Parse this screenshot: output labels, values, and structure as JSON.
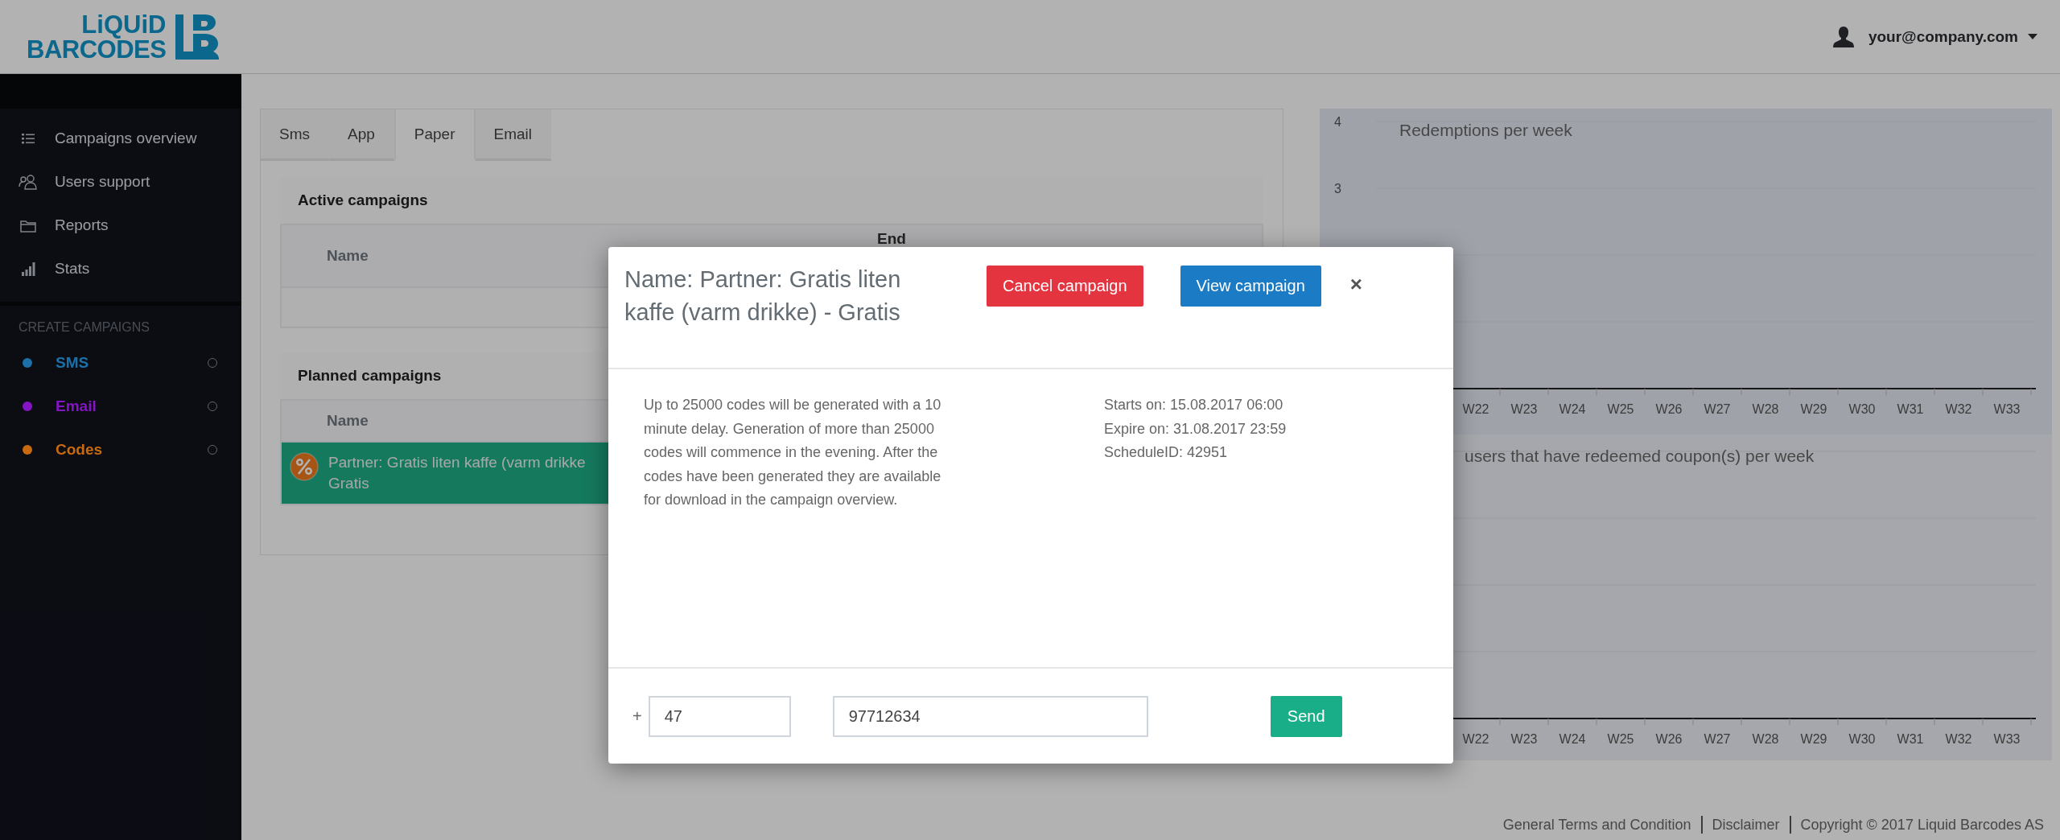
{
  "header": {
    "logo": {
      "line_1": "LiQUiD",
      "line_2": "BARCODES"
    },
    "user": {
      "email": "your@company.com"
    }
  },
  "sidebar": {
    "items": [
      {
        "label": "Campaigns overview"
      },
      {
        "label": "Users support"
      },
      {
        "label": "Reports"
      },
      {
        "label": "Stats"
      }
    ],
    "section_title": "CREATE CAMPAIGNS",
    "create_items": [
      {
        "label": "SMS",
        "color": "#1c70a8"
      },
      {
        "label": "Email",
        "color": "#8414c4"
      },
      {
        "label": "Codes",
        "color": "#c8690e"
      }
    ]
  },
  "tabs": [
    {
      "label": "Sms",
      "selected": false
    },
    {
      "label": "App",
      "selected": false
    },
    {
      "label": "Paper",
      "selected": true
    },
    {
      "label": "Email",
      "selected": false
    }
  ],
  "active_campaigns": {
    "title": "Active campaigns",
    "columns": [
      "Name",
      "End"
    ]
  },
  "planned_campaigns": {
    "title": "Planned campaigns",
    "columns": [
      "Name"
    ],
    "rows": [
      {
        "name_lines": [
          "Partner: Gratis liten kaffe (varm drikke",
          "Gratis"
        ],
        "selected": true
      }
    ]
  },
  "charts": [
    {
      "title": "Redemptions per week",
      "y_labels": [
        "4",
        "3"
      ],
      "x_labels": [
        "W22",
        "W23",
        "W24",
        "W25",
        "W26",
        "W27",
        "W28",
        "W29",
        "W30",
        "W31",
        "W32",
        "W33"
      ]
    },
    {
      "title": "users that have redeemed coupon(s) per week",
      "x_labels": [
        "W22",
        "W23",
        "W24",
        "W25",
        "W26",
        "W27",
        "W28",
        "W29",
        "W30",
        "W31",
        "W32",
        "W33"
      ]
    }
  ],
  "modal": {
    "title": "Name: Partner: Gratis liten kaffe (varm drikke) - Gratis",
    "buttons": [
      {
        "label": "Cancel campaign",
        "kind": "danger"
      },
      {
        "label": "View campaign",
        "kind": "primary"
      }
    ],
    "close": "×",
    "description": "Up to 25000 codes will be generated with a 10 minute delay. Generation of more than 25000 codes will commence in the evening. After the codes have been generated they are available for download in the campaign overview.",
    "details": [
      "Starts on: 15.08.2017 06:00",
      "Expire on: 31.08.2017 23:59",
      "ScheduleID: 42951"
    ],
    "phone": {
      "prefix": "+",
      "country_code": "47",
      "number": "97712634"
    },
    "send_button": "Send"
  },
  "footer": {
    "items": [
      "General Terms and Condition",
      "Disclaimer",
      "Copyright © 2017 Liquid Barcodes AS"
    ]
  }
}
